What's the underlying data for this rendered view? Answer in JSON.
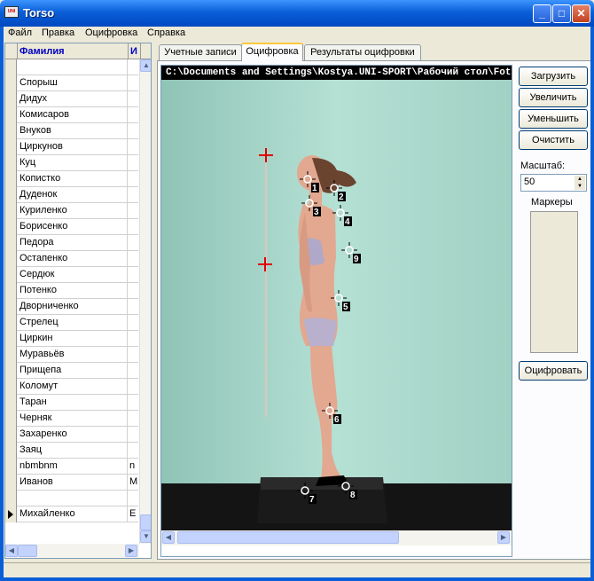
{
  "window": {
    "title": "Torso",
    "icon_text": "UNI",
    "controls": {
      "minimize": "_",
      "maximize": "□",
      "close": "✕"
    }
  },
  "menu": [
    "Файл",
    "Правка",
    "Оцифровка",
    "Справка"
  ],
  "grid": {
    "columns": [
      "Фамилия",
      "И"
    ],
    "rows": [
      {
        "name": "",
        "initial": ""
      },
      {
        "name": "Спорыш",
        "initial": ""
      },
      {
        "name": "Дидух",
        "initial": ""
      },
      {
        "name": "Комисаров",
        "initial": ""
      },
      {
        "name": "Внуков",
        "initial": ""
      },
      {
        "name": "Циркунов",
        "initial": ""
      },
      {
        "name": "Куц",
        "initial": ""
      },
      {
        "name": "Копистко",
        "initial": ""
      },
      {
        "name": "Дуденок",
        "initial": ""
      },
      {
        "name": "Куриленко",
        "initial": ""
      },
      {
        "name": "Борисенко",
        "initial": ""
      },
      {
        "name": "Педора",
        "initial": ""
      },
      {
        "name": "Остапенко",
        "initial": ""
      },
      {
        "name": "Сердюк",
        "initial": ""
      },
      {
        "name": "Потенко",
        "initial": ""
      },
      {
        "name": "Дворниченко",
        "initial": ""
      },
      {
        "name": "Стрелец",
        "initial": ""
      },
      {
        "name": "Циркин",
        "initial": ""
      },
      {
        "name": "Муравьёв",
        "initial": ""
      },
      {
        "name": "Прищепа",
        "initial": ""
      },
      {
        "name": "Коломут",
        "initial": ""
      },
      {
        "name": "Таран",
        "initial": ""
      },
      {
        "name": "Черняк",
        "initial": ""
      },
      {
        "name": "Захаренко",
        "initial": ""
      },
      {
        "name": "Заяц",
        "initial": ""
      },
      {
        "name": "nbmbnm",
        "initial": "n"
      },
      {
        "name": "Иванов",
        "initial": "М"
      },
      {
        "name": "",
        "initial": ""
      },
      {
        "name": "Михайленко",
        "initial": "Е"
      }
    ],
    "current_row_index": 28
  },
  "tabs": [
    "Учетные записи",
    "Оцифровка",
    "Результаты оцифровки"
  ],
  "active_tab": "Оцифровка",
  "file_path": "C:\\Documents and Settings\\Kostya.UNI-SPORT\\Рабочий стол\\Foto",
  "buttons": {
    "load": "Загрузить",
    "zoom_in": "Увеличить",
    "zoom_out": "Уменьшить",
    "clear": "Очистить",
    "digitize": "Оцифровать"
  },
  "scale_label": "Масштаб:",
  "scale_value": "50",
  "markers_label": "Маркеры",
  "point_markers": [
    "1",
    "2",
    "3",
    "4",
    "9",
    "5",
    "6",
    "7",
    "8"
  ],
  "colors": {
    "titlebar": "#0a5fd8",
    "wall": "#a8d6c8",
    "marker": "#ffffff",
    "calib_marker": "#e00000"
  }
}
